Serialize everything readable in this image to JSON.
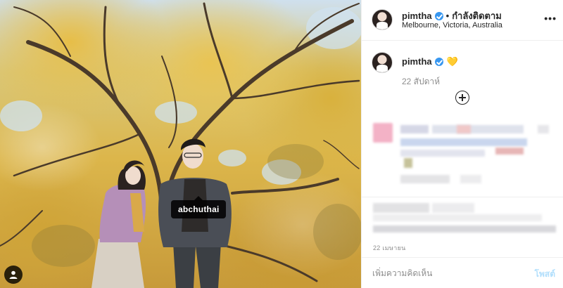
{
  "photo": {
    "tag_label": "abchuthai",
    "user_tag_icon": "person-icon"
  },
  "header": {
    "username": "pimtha",
    "verified_icon": "verified-badge-icon",
    "separator": "•",
    "follow_status": "กำลังติดตาม",
    "location": "Melbourne, Victoria, Australia",
    "more_icon": "more-options-icon",
    "more_label": "•••"
  },
  "caption": {
    "username": "pimtha",
    "heart": "💛",
    "time": "22 สัปดาห์",
    "expand_icon": "plus-circle-icon"
  },
  "footer": {
    "date": "22 เมษายน",
    "comment_placeholder": "เพิ่มความคิดเห็น",
    "post_label": "โพสต์"
  },
  "colors": {
    "accent": "#3897f0",
    "post_disabled": "#b2dffc",
    "muted": "#8e8e8e",
    "heart": "#f1d414"
  }
}
